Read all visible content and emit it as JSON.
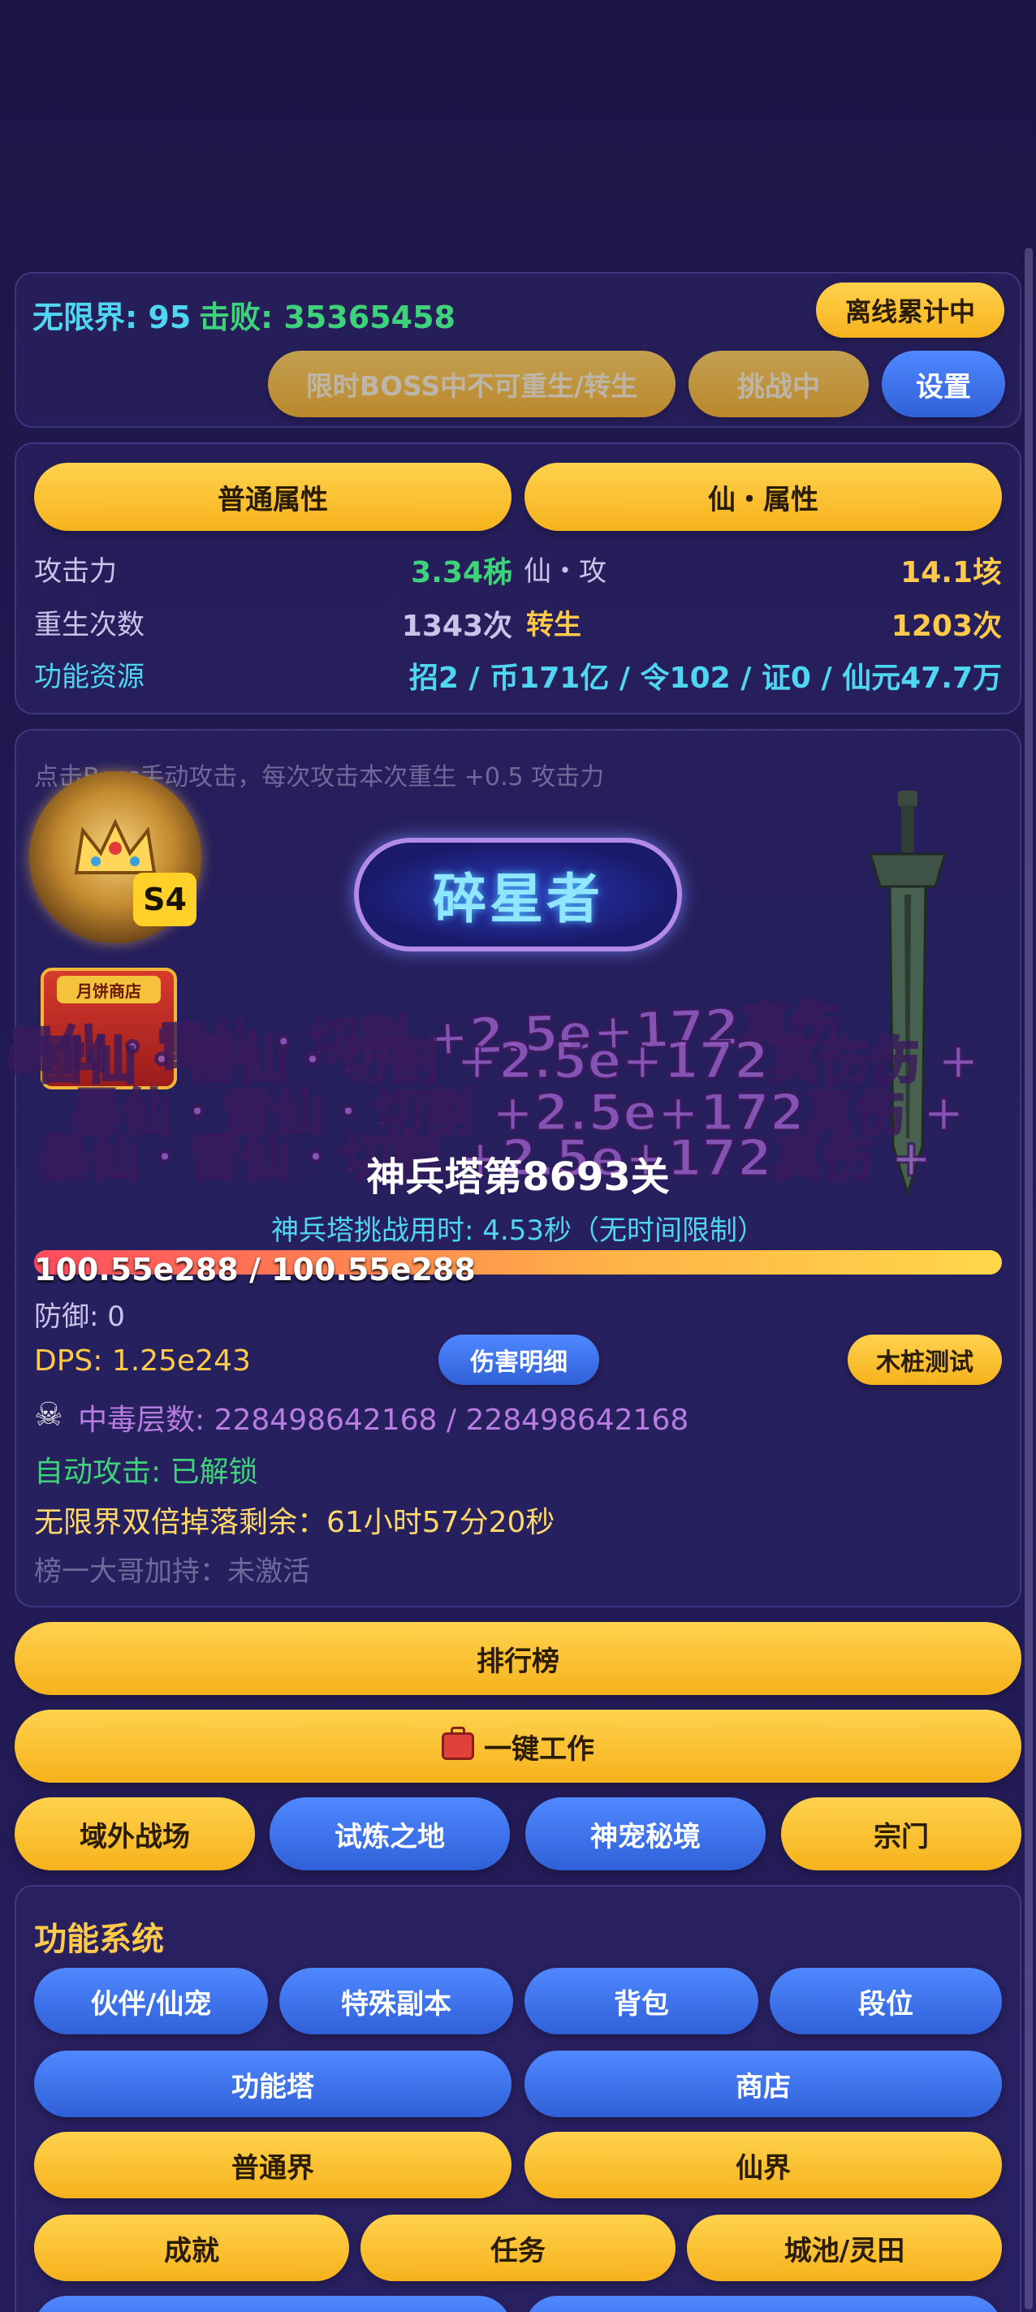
{
  "header": {
    "wuxianjie_label": "无限界: 95",
    "defeat_label": "击败: 35365458",
    "offline_btn": "离线累计中",
    "rebirth_lock_btn": "限时BOSS中不可重生/转生",
    "challenge_btn": "挑战中",
    "settings_btn": "设置"
  },
  "attributes": {
    "tab_normal": "普通属性",
    "tab_xian": "仙・属性",
    "rows": {
      "attack_label": "攻击力",
      "attack_value": "3.34秭",
      "xian_attack_label": "仙・攻",
      "xian_attack_value": "14.1垓",
      "rebirth_label": "重生次数",
      "rebirth_value": "1343次",
      "transmigrate_label": "转生",
      "transmigrate_value": "1203次",
      "resources_label": "功能资源",
      "resources_value": "招2 / 币171亿 / 令102 / 证0 / 仙元47.7万"
    }
  },
  "battle": {
    "hint": "点击Boss手动攻击，每次攻击本次重生 +0.5 攻击力",
    "badge_s": "S4",
    "shop_label": "月饼商店",
    "title_plaque": "碎星者",
    "tower_title": "神兵塔第8693关",
    "tower_time": "神兵塔挑战用时: 4.53秒（无时间限制）",
    "hp_text": "100.55e288 / 100.55e288",
    "hp_fraction": 1.0,
    "defense": "防御: 0",
    "dps": "DPS: 1.25e243",
    "damage_detail_btn": "伤害明细",
    "dummy_test_btn": "木桩测试",
    "poison": "中毒层数: 228498642168 / 228498642168",
    "auto_attack": "自动攻击: 已解锁",
    "double_drop": "无限界双倍掉落剩余：61小时57分20秒",
    "rank_buff": "榜一大哥加持：未激活",
    "floating_damage": [
      "暴仙・雷仙・切割 +2.5e+172真伤",
      "雷仙・雷仙・切割 +2.5e+172真伤伤 +",
      "暴仙・雷仙・切割 +2.5e+172真伤 +",
      "暴仙・雷仙・切割 +2.5e+172真伤 +"
    ]
  },
  "actions": {
    "leaderboard": "排行榜",
    "one_click_work": "一键工作",
    "outer_battlefield": "域外战场",
    "trial_land": "试炼之地",
    "pet_realm": "神宠秘境",
    "sect": "宗门"
  },
  "features": {
    "title": "功能系统",
    "companion": "伙伴/仙宠",
    "special_dungeon": "特殊副本",
    "backpack": "背包",
    "rank": "段位",
    "feature_tower": "功能塔",
    "shop": "商店",
    "normal_realm": "普通界",
    "xian_realm": "仙界",
    "achievement": "成就",
    "task": "任务",
    "city_field": "城池/灵田"
  },
  "colors": {
    "cyan": "#4fd6f0",
    "green": "#3ed27a",
    "gold": "#ffc94a",
    "purple": "#b77de0",
    "yellow_btn": "#f8bf2b",
    "blue_btn": "#3f74ec"
  }
}
